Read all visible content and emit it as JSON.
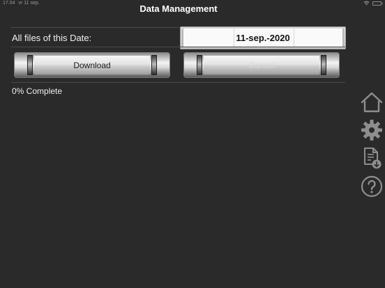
{
  "status_bar": {
    "time": "17.04",
    "date": "vr 11 sep."
  },
  "header": {
    "title": "Data Management"
  },
  "date_row": {
    "label": "All files of this Date:",
    "value": "11-sep.-2020"
  },
  "buttons": {
    "download_label": "Download",
    "cancel_label": "Cancel"
  },
  "progress": {
    "text": "0% Complete",
    "percent": 0
  },
  "sidebar": {
    "icons": [
      "home-icon",
      "gear-icon",
      "document-download-icon",
      "help-icon"
    ]
  },
  "colors": {
    "background": "#2b2a2a",
    "icon": "#8e8e8e"
  }
}
